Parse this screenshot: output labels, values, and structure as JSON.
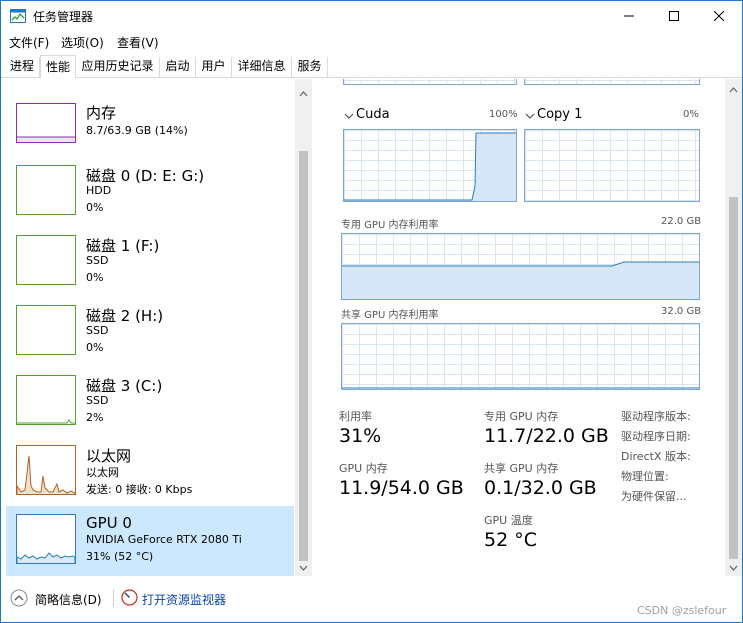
{
  "window": {
    "title": "任务管理器",
    "accent_color": "#1b79c9"
  },
  "menu": {
    "file": "文件(F)",
    "options": "选项(O)",
    "view": "查看(V)"
  },
  "tabs": [
    {
      "label": "进程"
    },
    {
      "label": "性能"
    },
    {
      "label": "应用历史记录"
    },
    {
      "label": "启动"
    },
    {
      "label": "用户"
    },
    {
      "label": "详细信息"
    },
    {
      "label": "服务"
    }
  ],
  "resources": [
    {
      "name": "内存",
      "line1": "8.7/63.9 GB (14%)",
      "line2": "",
      "color": "#8b2bb2"
    },
    {
      "name": "磁盘 0 (D: E: G:)",
      "line1": "HDD",
      "line2": "0%",
      "color": "#53a02b"
    },
    {
      "name": "磁盘 1 (F:)",
      "line1": "SSD",
      "line2": "0%",
      "color": "#53a02b"
    },
    {
      "name": "磁盘 2 (H:)",
      "line1": "SSD",
      "line2": "0%",
      "color": "#53a02b"
    },
    {
      "name": "磁盘 3 (C:)",
      "line1": "SSD",
      "line2": "2%",
      "color": "#53a02b"
    },
    {
      "name": "以太网",
      "line1": "以太网",
      "line2": "发送: 0 接收: 0 Kbps",
      "color": "#a7642c"
    },
    {
      "name": "GPU 0",
      "line1": "NVIDIA GeForce RTX 2080 Ti",
      "line2": "31% (52 °C)",
      "color": "#2a7bbd"
    }
  ],
  "gpu_detail": {
    "engines": [
      {
        "name": "Cuda",
        "percent": "100%"
      },
      {
        "name": "Copy 1",
        "percent": "0%"
      }
    ],
    "dedicated": {
      "label": "专用 GPU 内存利用率",
      "max": "22.0 GB"
    },
    "shared": {
      "label": "共享 GPU 内存利用率",
      "max": "32.0 GB"
    },
    "stats": {
      "utilization": {
        "label": "利用率",
        "value": "31%"
      },
      "dedicated_mem": {
        "label": "专用 GPU 内存",
        "value": "11.7/22.0 GB"
      },
      "gpu_mem": {
        "label": "GPU 内存",
        "value": "11.9/54.0 GB"
      },
      "shared_mem": {
        "label": "共享 GPU 内存",
        "value": "0.1/32.0 GB"
      },
      "temperature": {
        "label": "GPU 温度",
        "value": "52 °C"
      }
    },
    "info_labels": [
      "驱动程序版本:",
      "驱动程序日期:",
      "DirectX 版本:",
      "物理位置:",
      "为硬件保留..."
    ]
  },
  "statusbar": {
    "brief": "简略信息(D)",
    "open_monitor": "打开资源监视器"
  },
  "watermark": "CSDN @zslefour"
}
